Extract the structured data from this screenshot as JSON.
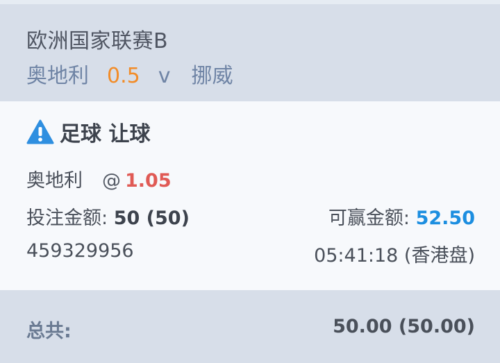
{
  "header": {
    "league": "欧洲国家联赛B",
    "home_team": "奥地利",
    "handicap": "0.5",
    "vs": "v",
    "away_team": "挪威"
  },
  "bet": {
    "warning_icon": "warning-icon",
    "title": "足球 让球",
    "selection": "奥地利",
    "at": "@",
    "odds": "1.05",
    "stake_label": "投注金额:",
    "stake_value": "50 (50)",
    "win_label": "可赢金额:",
    "win_value": "52.50",
    "ticket_id": "459329956",
    "time": "05:41:18 (香港盘)"
  },
  "footer": {
    "total_label": "总共:",
    "total_value": "50.00 (50.00)"
  },
  "colors": {
    "header_bg": "#d7dee9",
    "body_bg": "#f7f9fc",
    "handicap": "#f28c28",
    "odds": "#e05a55",
    "win": "#1c8ee0",
    "warning": "#2f8fe0"
  }
}
